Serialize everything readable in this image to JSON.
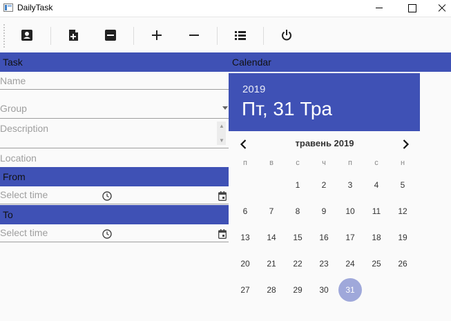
{
  "window": {
    "title": "DailyTask"
  },
  "toolbar": {
    "buttons": [
      {
        "icon": "contact-card-icon"
      },
      {
        "icon": "add-note-icon"
      },
      {
        "icon": "remove-box-icon"
      },
      {
        "icon": "plus-icon"
      },
      {
        "icon": "minus-icon"
      },
      {
        "icon": "list-icon"
      },
      {
        "icon": "power-icon"
      }
    ]
  },
  "task": {
    "header": "Task",
    "name_label": "Name",
    "group_label": "Group",
    "description_label": "Description",
    "location_label": "Location",
    "from_header": "From",
    "from_time_placeholder": "Select time",
    "to_header": "To",
    "to_time_placeholder": "Select time"
  },
  "calendar": {
    "header": "Calendar",
    "year": "2019",
    "selected_date": "Пт, 31 Тра",
    "month_label": "травень 2019",
    "weekdays": [
      "п",
      "в",
      "с",
      "ч",
      "п",
      "с",
      "н"
    ],
    "weeks": [
      [
        "",
        "",
        "1",
        "2",
        "3",
        "4",
        "5"
      ],
      [
        "6",
        "7",
        "8",
        "9",
        "10",
        "11",
        "12"
      ],
      [
        "13",
        "14",
        "15",
        "16",
        "17",
        "18",
        "19"
      ],
      [
        "20",
        "21",
        "22",
        "23",
        "24",
        "25",
        "26"
      ],
      [
        "27",
        "28",
        "29",
        "30",
        "31",
        "",
        ""
      ]
    ],
    "selected_day": "31",
    "accent_color": "#3f51b5",
    "selected_day_color": "#9fa8da"
  }
}
